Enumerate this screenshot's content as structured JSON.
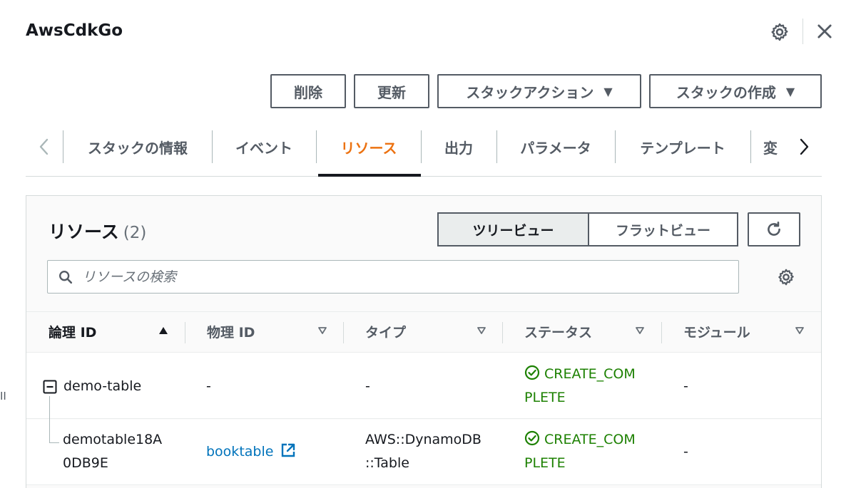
{
  "header": {
    "title": "AwsCdkGo"
  },
  "actions": {
    "delete": "削除",
    "update": "更新",
    "stack_actions": "スタックアクション",
    "create_stack": "スタックの作成",
    "caret": "▼"
  },
  "tabs": [
    {
      "label": "スタックの情報"
    },
    {
      "label": "イベント"
    },
    {
      "label": "リソース"
    },
    {
      "label": "出力"
    },
    {
      "label": "パラメータ"
    },
    {
      "label": "テンプレート"
    },
    {
      "label": "変"
    }
  ],
  "active_tab": "リソース",
  "resources": {
    "title": "リソース",
    "count": "(2)",
    "view_tree": "ツリービュー",
    "view_flat": "フラットビュー",
    "search_placeholder": "リソースの検索",
    "columns": [
      {
        "label": "論理 ID",
        "sort": "▲"
      },
      {
        "label": "物理 ID",
        "sort": "▽"
      },
      {
        "label": "タイプ",
        "sort": "▽"
      },
      {
        "label": "ステータス",
        "sort": "▽"
      },
      {
        "label": "モジュール",
        "sort": "▽"
      }
    ],
    "rows": [
      {
        "logical_id": "demo-table",
        "physical_id": "-",
        "type": "-",
        "status_line1": "CREATE_COM",
        "status_line2": "PLETE",
        "module": "-"
      },
      {
        "logical_id_line1": "demotable18A",
        "logical_id_line2": "0DB9E",
        "physical_id": "booktable",
        "type_line1": "AWS::DynamoDB",
        "type_line2": "::Table",
        "status_line1": "CREATE_COM",
        "status_line2": "PLETE",
        "module": "-"
      }
    ]
  },
  "edge_text": "II",
  "colors": {
    "accent": "#ec7211",
    "success": "#1d8102",
    "link": "#0073bb",
    "text": "#16191f",
    "muted": "#545b64"
  }
}
